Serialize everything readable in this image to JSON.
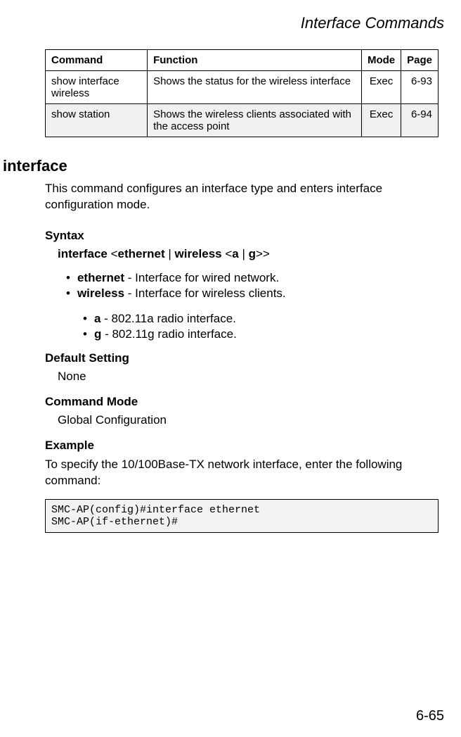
{
  "header": {
    "title": "Interface Commands"
  },
  "table": {
    "headers": {
      "cmd": "Command",
      "func": "Function",
      "mode": "Mode",
      "page": "Page"
    },
    "rows": [
      {
        "cmd": "show interface wireless",
        "func": "Shows the status for the wireless interface",
        "mode": "Exec",
        "page": "6-93"
      },
      {
        "cmd": "show station",
        "func": "Shows the wireless clients associated with the access point",
        "mode": "Exec",
        "page": "6-94"
      }
    ]
  },
  "section": {
    "name": "interface",
    "description": "This command configures an interface type and enters interface configuration mode.",
    "syntax_label": "Syntax",
    "syntax": {
      "kw_interface": "interface",
      "lt1": "<",
      "kw_eth": "ethernet",
      "pipe1": " | ",
      "kw_wireless": "wireless",
      "lt2": " <",
      "kw_a": "a",
      "pipe2": " | ",
      "kw_g": "g",
      "gt": ">>"
    },
    "bullets": [
      {
        "b": "ethernet",
        "rest": " - Interface for wired network."
      },
      {
        "b": "wireless",
        "rest": " - Interface for wireless clients."
      }
    ],
    "sub_bullets": [
      {
        "b": "a",
        "rest": " - 802.11a radio interface."
      },
      {
        "b": "g",
        "rest": " - 802.11g radio interface."
      }
    ],
    "default_label": "Default Setting",
    "default_value": "None",
    "mode_label": "Command Mode",
    "mode_value": "Global Configuration",
    "example_label": "Example",
    "example_desc": "To specify the 10/100Base-TX network interface, enter the following command:",
    "example_code": "SMC-AP(config)#interface ethernet\nSMC-AP(if-ethernet)#"
  },
  "footer": {
    "page": "6-65"
  }
}
